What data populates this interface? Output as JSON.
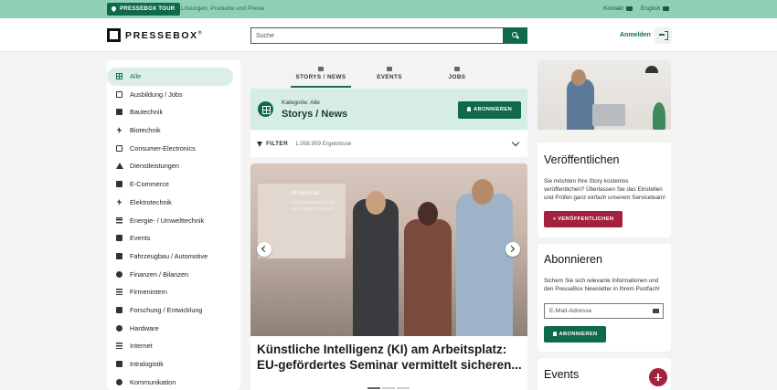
{
  "topbar": {
    "tour_label": "PRESSEBOX TOUR",
    "tagline": "Lösungen, Produkte und Preise",
    "contact_label": "Kontakt",
    "language_label": "English"
  },
  "header": {
    "logo_text": "PRESSEBOX",
    "logo_mark": "®",
    "search_placeholder": "Suche",
    "login_label": "Anmelden"
  },
  "sidebar": {
    "items": [
      {
        "label": "Alle",
        "icon": "grid-icon"
      },
      {
        "label": "Ausbildung / Jobs",
        "icon": "presentation-icon"
      },
      {
        "label": "Bautechnik",
        "icon": "excavator-icon"
      },
      {
        "label": "Biotechnik",
        "icon": "pipette-icon"
      },
      {
        "label": "Consumer-Electronics",
        "icon": "devices-icon"
      },
      {
        "label": "Dienstleistungen",
        "icon": "service-bell-icon"
      },
      {
        "label": "E-Commerce",
        "icon": "cart-icon"
      },
      {
        "label": "Elektrotechnik",
        "icon": "bolt-icon"
      },
      {
        "label": "Energie- / Umwelttechnik",
        "icon": "solar-panel-icon"
      },
      {
        "label": "Events",
        "icon": "calendar-icon"
      },
      {
        "label": "Fahrzeugbau / Automotive",
        "icon": "car-icon"
      },
      {
        "label": "Finanzen / Bilanzen",
        "icon": "piggy-bank-icon"
      },
      {
        "label": "Firmenintern",
        "icon": "building-icon"
      },
      {
        "label": "Forschung / Entwicklung",
        "icon": "microscope-icon"
      },
      {
        "label": "Hardware",
        "icon": "chip-icon"
      },
      {
        "label": "Internet",
        "icon": "network-icon"
      },
      {
        "label": "Intralogistik",
        "icon": "forklift-icon"
      },
      {
        "label": "Kommunikation",
        "icon": "satellite-icon"
      }
    ]
  },
  "tabs": [
    {
      "label": "STORYS / NEWS",
      "active": true
    },
    {
      "label": "EVENTS",
      "active": false
    },
    {
      "label": "JOBS",
      "active": false
    }
  ],
  "category": {
    "label": "Kategorie: Alle",
    "title": "Storys / News",
    "subscribe_label": "ABONNIEREN"
  },
  "filter": {
    "label": "FILTER",
    "count": "1.058.959 Ergebnisse"
  },
  "slider": {
    "screen_title": "KI-Seminar:",
    "screen_subtitle": "Kompetenzaufbau für eine digitale Zukunft",
    "headline": "Künstliche Intelligenz (KI) am Arbeitsplatz: EU-gefördertes Seminar vermittelt sicheren..."
  },
  "publish_card": {
    "title": "Veröffentlichen",
    "text": "Sie möchten Ihre Story kostenlos veröffentlichen? Überlassen Sie das Einstellen und Prüfen ganz einfach unserem Serviceteam!",
    "button_label": "VERÖFFENTLICHEN"
  },
  "subscribe_card": {
    "title": "Abonnieren",
    "text": "Sichern Sie sich relevante Informationen und den PresseBox Newsletter in Ihrem Postfach!",
    "email_placeholder": "E-Mail-Adresse",
    "button_label": "ABONNIEREN"
  },
  "events_card": {
    "title": "Events"
  },
  "colors": {
    "brand_green": "#0f6a4a",
    "topbar_green": "#8fd1b5",
    "accent_red": "#a3203f"
  }
}
